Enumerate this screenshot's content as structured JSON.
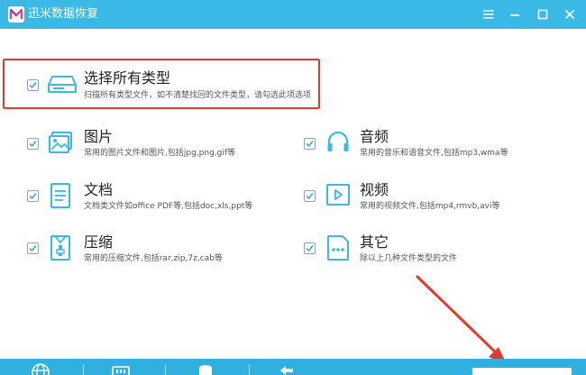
{
  "app": {
    "title": "迅米数据恢复",
    "logo_icon": "m-logo-icon"
  },
  "window_controls": [
    "menu-icon",
    "minimize-icon",
    "maximize-icon",
    "close-icon"
  ],
  "colors": {
    "titlebar": "#3ab8e6",
    "icon": "#3ab8e6",
    "highlight": "#e33a2e",
    "bottombar": "#2fb0df"
  },
  "select_all": {
    "title": "选择所有类型",
    "desc": "扫描所有类型文件，如不清楚找回的文件类型，请勾选此项选项",
    "checked": true,
    "icon": "drive-icon"
  },
  "categories": [
    {
      "title": "图片",
      "desc": "常用的图片文件和图片,包括jpg,png,gif等",
      "checked": true,
      "icon": "image-icon"
    },
    {
      "title": "音频",
      "desc": "常用的音乐和语音文件,包括mp3,wma等",
      "checked": true,
      "icon": "headphones-icon"
    },
    {
      "title": "文档",
      "desc": "文档类文件如office PDF等,包括doc,xls,ppt等",
      "checked": true,
      "icon": "document-icon"
    },
    {
      "title": "视频",
      "desc": "常用的视频文件,包括mp4,rmvb,avi等",
      "checked": true,
      "icon": "video-icon"
    },
    {
      "title": "压缩",
      "desc": "常用的压缩文件,包括rar,zip,7z,cab等",
      "checked": true,
      "icon": "archive-icon"
    },
    {
      "title": "其它",
      "desc": "除以上几种文件类型的文件",
      "checked": true,
      "icon": "other-icon"
    }
  ],
  "bottom_toolbar": [
    "globe-icon",
    "memory-card-icon",
    "database-icon",
    "back-arrow-icon"
  ]
}
